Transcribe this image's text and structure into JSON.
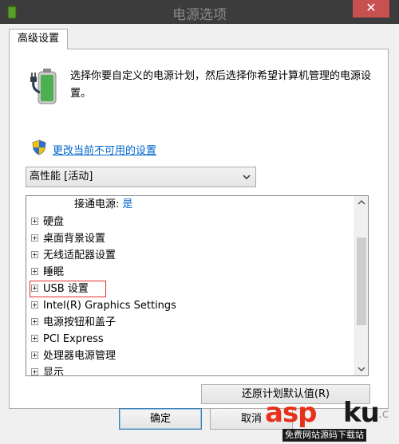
{
  "titlebar": {
    "title": "电源选项",
    "close_glyph": "✕",
    "app_icon": "power-options-icon"
  },
  "tab": {
    "label": "高级设置"
  },
  "panel": {
    "description": "选择你要自定义的电源计划，然后选择你希望计算机管理的电源设置。",
    "battery_icon": "battery-plug-icon",
    "shield_icon": "uac-shield-icon",
    "change_link": "更改当前不可用的设置"
  },
  "plan_select": {
    "value": "高性能 [活动]"
  },
  "tree": {
    "ac_power_label": "接通电源:",
    "ac_power_value": "是",
    "items": [
      {
        "label": "硬盘"
      },
      {
        "label": "桌面背景设置"
      },
      {
        "label": "无线适配器设置"
      },
      {
        "label": "睡眠"
      },
      {
        "label": "USB 设置",
        "highlighted": true
      },
      {
        "label": "Intel(R) Graphics Settings"
      },
      {
        "label": "电源按钮和盖子"
      },
      {
        "label": "PCI Express"
      },
      {
        "label": "处理器电源管理"
      },
      {
        "label": "显示"
      }
    ]
  },
  "buttons": {
    "restore": "还原计划默认值(R)",
    "ok": "确定",
    "cancel": "取消"
  },
  "watermark": {
    "asp": "asp",
    "ku": "ku",
    "dot": ".c",
    "tagline": "免费网站源码下载站"
  },
  "colors": {
    "link": "#0066cc",
    "highlight_border": "#e03030",
    "titlebar": "#3c3c3c",
    "close_button": "#c75050"
  }
}
